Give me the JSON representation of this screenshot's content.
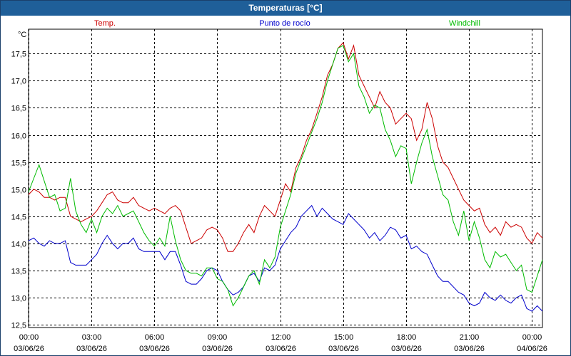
{
  "window": {
    "title": "Temperaturas [°C]"
  },
  "chart_data": {
    "type": "line",
    "ylabel": "°C",
    "ylim": [
      12.45,
      17.95
    ],
    "y_ticks": [
      "12,5",
      "13,0",
      "13,5",
      "14,0",
      "14,5",
      "15,0",
      "15,5",
      "16,0",
      "16,5",
      "17,0",
      "17,5"
    ],
    "x_ticks": [
      {
        "time": "00:00",
        "date": "03/06/26"
      },
      {
        "time": "03:00",
        "date": "03/06/26"
      },
      {
        "time": "06:00",
        "date": "03/06/26"
      },
      {
        "time": "09:00",
        "date": "03/06/26"
      },
      {
        "time": "12:00",
        "date": "03/06/26"
      },
      {
        "time": "15:00",
        "date": "03/06/26"
      },
      {
        "time": "18:00",
        "date": "03/06/26"
      },
      {
        "time": "21:00",
        "date": "03/06/26"
      },
      {
        "time": "00:00",
        "date": "04/06/26"
      }
    ],
    "grid": true,
    "legend_position": "top",
    "x_unit": "hours since 00:00 03/06/26",
    "series": [
      {
        "name": "Temp.",
        "color": "#cc0000",
        "points": [
          [
            0,
            14.9
          ],
          [
            0.25,
            15.0
          ],
          [
            0.5,
            14.95
          ],
          [
            0.75,
            14.85
          ],
          [
            1,
            14.85
          ],
          [
            1.25,
            14.8
          ],
          [
            1.5,
            14.85
          ],
          [
            1.75,
            14.85
          ],
          [
            2,
            14.5
          ],
          [
            2.25,
            14.45
          ],
          [
            2.5,
            14.4
          ],
          [
            2.75,
            14.45
          ],
          [
            3,
            14.5
          ],
          [
            3.25,
            14.6
          ],
          [
            3.5,
            14.75
          ],
          [
            3.75,
            14.9
          ],
          [
            4,
            14.95
          ],
          [
            4.25,
            14.8
          ],
          [
            4.5,
            14.75
          ],
          [
            4.75,
            14.75
          ],
          [
            5,
            14.85
          ],
          [
            5.25,
            14.7
          ],
          [
            5.5,
            14.65
          ],
          [
            5.75,
            14.6
          ],
          [
            6,
            14.65
          ],
          [
            6.25,
            14.6
          ],
          [
            6.5,
            14.55
          ],
          [
            6.75,
            14.65
          ],
          [
            7,
            14.7
          ],
          [
            7.25,
            14.6
          ],
          [
            7.5,
            14.3
          ],
          [
            7.75,
            14.0
          ],
          [
            8,
            14.05
          ],
          [
            8.25,
            14.1
          ],
          [
            8.5,
            14.25
          ],
          [
            8.75,
            14.3
          ],
          [
            9,
            14.25
          ],
          [
            9.25,
            14.1
          ],
          [
            9.5,
            13.85
          ],
          [
            9.75,
            13.85
          ],
          [
            10,
            14.0
          ],
          [
            10.25,
            14.2
          ],
          [
            10.5,
            14.35
          ],
          [
            10.75,
            14.2
          ],
          [
            11,
            14.5
          ],
          [
            11.25,
            14.7
          ],
          [
            11.5,
            14.6
          ],
          [
            11.75,
            14.5
          ],
          [
            12,
            14.8
          ],
          [
            12.25,
            15.1
          ],
          [
            12.5,
            14.95
          ],
          [
            12.75,
            15.4
          ],
          [
            13,
            15.6
          ],
          [
            13.25,
            15.9
          ],
          [
            13.5,
            16.1
          ],
          [
            13.75,
            16.4
          ],
          [
            14,
            16.7
          ],
          [
            14.25,
            17.1
          ],
          [
            14.5,
            17.3
          ],
          [
            14.75,
            17.6
          ],
          [
            15,
            17.7
          ],
          [
            15.25,
            17.4
          ],
          [
            15.5,
            17.65
          ],
          [
            15.75,
            17.1
          ],
          [
            16,
            16.9
          ],
          [
            16.25,
            16.7
          ],
          [
            16.5,
            16.5
          ],
          [
            16.75,
            16.8
          ],
          [
            17,
            16.6
          ],
          [
            17.25,
            16.5
          ],
          [
            17.5,
            16.2
          ],
          [
            17.75,
            16.3
          ],
          [
            18,
            16.4
          ],
          [
            18.25,
            16.3
          ],
          [
            18.5,
            15.9
          ],
          [
            18.75,
            16.1
          ],
          [
            19,
            16.6
          ],
          [
            19.25,
            16.3
          ],
          [
            19.5,
            15.8
          ],
          [
            19.75,
            15.5
          ],
          [
            20,
            15.4
          ],
          [
            20.25,
            15.2
          ],
          [
            20.5,
            15.0
          ],
          [
            20.75,
            14.8
          ],
          [
            21,
            14.7
          ],
          [
            21.25,
            14.6
          ],
          [
            21.5,
            14.65
          ],
          [
            21.75,
            14.35
          ],
          [
            22,
            14.2
          ],
          [
            22.25,
            14.3
          ],
          [
            22.5,
            14.15
          ],
          [
            22.75,
            14.4
          ],
          [
            23,
            14.3
          ],
          [
            23.25,
            14.35
          ],
          [
            23.5,
            14.3
          ],
          [
            23.75,
            14.1
          ],
          [
            24,
            14.0
          ],
          [
            24.25,
            14.2
          ],
          [
            24.5,
            14.1
          ]
        ]
      },
      {
        "name": "Punto de rocío",
        "color": "#0000cc",
        "points": [
          [
            0,
            14.05
          ],
          [
            0.25,
            14.1
          ],
          [
            0.5,
            14.0
          ],
          [
            0.75,
            13.95
          ],
          [
            1,
            14.05
          ],
          [
            1.25,
            14.0
          ],
          [
            1.5,
            14.0
          ],
          [
            1.75,
            14.05
          ],
          [
            2,
            13.65
          ],
          [
            2.25,
            13.6
          ],
          [
            2.5,
            13.6
          ],
          [
            2.75,
            13.6
          ],
          [
            3,
            13.7
          ],
          [
            3.25,
            13.8
          ],
          [
            3.5,
            14.0
          ],
          [
            3.75,
            14.15
          ],
          [
            4,
            14.0
          ],
          [
            4.25,
            13.9
          ],
          [
            4.5,
            14.0
          ],
          [
            4.75,
            14.0
          ],
          [
            5,
            14.1
          ],
          [
            5.25,
            13.9
          ],
          [
            5.5,
            13.85
          ],
          [
            5.75,
            13.85
          ],
          [
            6,
            13.85
          ],
          [
            6.25,
            13.85
          ],
          [
            6.5,
            13.7
          ],
          [
            6.75,
            13.85
          ],
          [
            7,
            13.85
          ],
          [
            7.25,
            13.6
          ],
          [
            7.5,
            13.3
          ],
          [
            7.75,
            13.25
          ],
          [
            8,
            13.25
          ],
          [
            8.25,
            13.35
          ],
          [
            8.5,
            13.5
          ],
          [
            8.75,
            13.55
          ],
          [
            9,
            13.5
          ],
          [
            9.25,
            13.3
          ],
          [
            9.5,
            13.15
          ],
          [
            9.75,
            13.05
          ],
          [
            10,
            13.1
          ],
          [
            10.25,
            13.2
          ],
          [
            10.5,
            13.4
          ],
          [
            10.75,
            13.45
          ],
          [
            11,
            13.3
          ],
          [
            11.25,
            13.55
          ],
          [
            11.5,
            13.5
          ],
          [
            11.75,
            13.6
          ],
          [
            12,
            13.9
          ],
          [
            12.25,
            14.05
          ],
          [
            12.5,
            14.2
          ],
          [
            12.75,
            14.3
          ],
          [
            13,
            14.5
          ],
          [
            13.25,
            14.6
          ],
          [
            13.5,
            14.7
          ],
          [
            13.75,
            14.5
          ],
          [
            14,
            14.65
          ],
          [
            14.25,
            14.55
          ],
          [
            14.5,
            14.45
          ],
          [
            14.75,
            14.4
          ],
          [
            15,
            14.35
          ],
          [
            15.25,
            14.55
          ],
          [
            15.5,
            14.45
          ],
          [
            15.75,
            14.35
          ],
          [
            16,
            14.25
          ],
          [
            16.25,
            14.1
          ],
          [
            16.5,
            14.2
          ],
          [
            16.75,
            14.05
          ],
          [
            17,
            14.15
          ],
          [
            17.25,
            14.3
          ],
          [
            17.5,
            14.25
          ],
          [
            17.75,
            14.1
          ],
          [
            18,
            14.15
          ],
          [
            18.25,
            13.9
          ],
          [
            18.5,
            13.95
          ],
          [
            18.75,
            13.85
          ],
          [
            19,
            13.8
          ],
          [
            19.25,
            13.6
          ],
          [
            19.5,
            13.4
          ],
          [
            19.75,
            13.3
          ],
          [
            20,
            13.3
          ],
          [
            20.25,
            13.2
          ],
          [
            20.5,
            13.1
          ],
          [
            20.75,
            13.05
          ],
          [
            21,
            12.9
          ],
          [
            21.25,
            12.85
          ],
          [
            21.5,
            12.9
          ],
          [
            21.75,
            13.1
          ],
          [
            22,
            13.0
          ],
          [
            22.25,
            12.95
          ],
          [
            22.5,
            13.05
          ],
          [
            22.75,
            12.95
          ],
          [
            23,
            12.9
          ],
          [
            23.25,
            13.0
          ],
          [
            23.5,
            13.05
          ],
          [
            23.75,
            12.8
          ],
          [
            24,
            12.75
          ],
          [
            24.25,
            12.85
          ],
          [
            24.5,
            12.75
          ]
        ]
      },
      {
        "name": "Windchill",
        "color": "#00bb00",
        "points": [
          [
            0,
            14.95
          ],
          [
            0.25,
            15.2
          ],
          [
            0.5,
            15.45
          ],
          [
            0.75,
            15.15
          ],
          [
            1,
            14.85
          ],
          [
            1.25,
            14.9
          ],
          [
            1.5,
            14.6
          ],
          [
            1.75,
            14.65
          ],
          [
            2,
            15.2
          ],
          [
            2.25,
            14.6
          ],
          [
            2.5,
            14.35
          ],
          [
            2.75,
            14.2
          ],
          [
            3,
            14.45
          ],
          [
            3.25,
            14.2
          ],
          [
            3.5,
            14.5
          ],
          [
            3.75,
            14.65
          ],
          [
            4,
            14.55
          ],
          [
            4.25,
            14.7
          ],
          [
            4.5,
            14.5
          ],
          [
            4.75,
            14.55
          ],
          [
            5,
            14.6
          ],
          [
            5.25,
            14.4
          ],
          [
            5.5,
            14.2
          ],
          [
            5.75,
            14.05
          ],
          [
            6,
            13.95
          ],
          [
            6.25,
            14.1
          ],
          [
            6.5,
            13.95
          ],
          [
            6.75,
            14.5
          ],
          [
            7,
            14.05
          ],
          [
            7.25,
            13.7
          ],
          [
            7.5,
            13.5
          ],
          [
            7.75,
            13.45
          ],
          [
            8,
            13.45
          ],
          [
            8.25,
            13.4
          ],
          [
            8.5,
            13.55
          ],
          [
            8.75,
            13.55
          ],
          [
            9,
            13.35
          ],
          [
            9.25,
            13.3
          ],
          [
            9.5,
            13.15
          ],
          [
            9.75,
            12.85
          ],
          [
            10,
            13.0
          ],
          [
            10.25,
            13.2
          ],
          [
            10.5,
            13.4
          ],
          [
            10.75,
            13.5
          ],
          [
            11,
            13.25
          ],
          [
            11.25,
            13.7
          ],
          [
            11.5,
            13.55
          ],
          [
            11.75,
            13.75
          ],
          [
            12,
            14.3
          ],
          [
            12.25,
            14.6
          ],
          [
            12.5,
            14.9
          ],
          [
            12.75,
            15.3
          ],
          [
            13,
            15.55
          ],
          [
            13.25,
            15.8
          ],
          [
            13.5,
            16.05
          ],
          [
            13.75,
            16.3
          ],
          [
            14,
            16.6
          ],
          [
            14.25,
            17.0
          ],
          [
            14.5,
            17.3
          ],
          [
            14.75,
            17.6
          ],
          [
            15,
            17.65
          ],
          [
            15.25,
            17.35
          ],
          [
            15.5,
            17.5
          ],
          [
            15.75,
            16.9
          ],
          [
            16,
            16.7
          ],
          [
            16.25,
            16.4
          ],
          [
            16.5,
            16.55
          ],
          [
            16.75,
            16.5
          ],
          [
            17,
            16.1
          ],
          [
            17.25,
            15.9
          ],
          [
            17.5,
            15.6
          ],
          [
            17.75,
            15.8
          ],
          [
            18,
            15.75
          ],
          [
            18.25,
            15.1
          ],
          [
            18.5,
            15.5
          ],
          [
            18.75,
            15.85
          ],
          [
            19,
            16.1
          ],
          [
            19.25,
            15.6
          ],
          [
            19.5,
            15.25
          ],
          [
            19.75,
            14.9
          ],
          [
            20,
            14.8
          ],
          [
            20.25,
            14.4
          ],
          [
            20.5,
            14.15
          ],
          [
            20.75,
            14.6
          ],
          [
            21,
            14.05
          ],
          [
            21.25,
            14.4
          ],
          [
            21.5,
            14.1
          ],
          [
            21.75,
            13.7
          ],
          [
            22,
            13.55
          ],
          [
            22.25,
            13.85
          ],
          [
            22.5,
            13.75
          ],
          [
            22.75,
            13.8
          ],
          [
            23,
            13.65
          ],
          [
            23.25,
            13.5
          ],
          [
            23.5,
            13.6
          ],
          [
            23.75,
            13.15
          ],
          [
            24,
            13.1
          ],
          [
            24.25,
            13.4
          ],
          [
            24.5,
            13.7
          ]
        ]
      }
    ]
  }
}
